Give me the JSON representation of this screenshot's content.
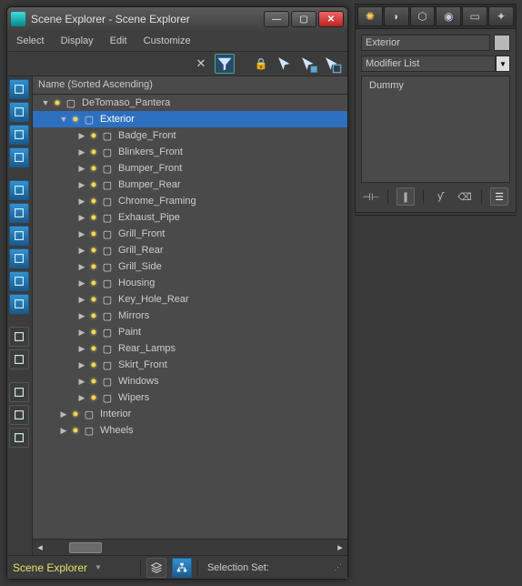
{
  "window": {
    "title": "Scene Explorer - Scene Explorer",
    "menus": {
      "select": "Select",
      "display": "Display",
      "edit": "Edit",
      "customize": "Customize"
    },
    "column_header": "Name (Sorted Ascending)",
    "status_label": "Scene Explorer",
    "selection_set_label": "Selection Set:"
  },
  "side_tool_names": [
    "sphere-icon",
    "camera-icon",
    "select-all-icon",
    "video-icon",
    "freeze-icon",
    "layers-icon",
    "hide-icon",
    "highlight-icon",
    "snow-icon",
    "expand-icon",
    "list-icon",
    "page-icon",
    "filter-icon",
    "settings-icon",
    "link-icon"
  ],
  "tree": [
    {
      "depth": 0,
      "arrow": "down",
      "label": "DeTomaso_Pantera",
      "selected": false
    },
    {
      "depth": 1,
      "arrow": "down",
      "label": "Exterior",
      "selected": true
    },
    {
      "depth": 2,
      "arrow": "right",
      "label": "Badge_Front"
    },
    {
      "depth": 2,
      "arrow": "right",
      "label": "Blinkers_Front"
    },
    {
      "depth": 2,
      "arrow": "right",
      "label": "Bumper_Front"
    },
    {
      "depth": 2,
      "arrow": "right",
      "label": "Bumper_Rear"
    },
    {
      "depth": 2,
      "arrow": "right",
      "label": "Chrome_Framing"
    },
    {
      "depth": 2,
      "arrow": "right",
      "label": "Exhaust_Pipe"
    },
    {
      "depth": 2,
      "arrow": "right",
      "label": "Grill_Front"
    },
    {
      "depth": 2,
      "arrow": "right",
      "label": "Grill_Rear"
    },
    {
      "depth": 2,
      "arrow": "right",
      "label": "Grill_Side"
    },
    {
      "depth": 2,
      "arrow": "right",
      "label": "Housing"
    },
    {
      "depth": 2,
      "arrow": "right",
      "label": "Key_Hole_Rear"
    },
    {
      "depth": 2,
      "arrow": "right",
      "label": "Mirrors"
    },
    {
      "depth": 2,
      "arrow": "right",
      "label": "Paint"
    },
    {
      "depth": 2,
      "arrow": "right",
      "label": "Rear_Lamps"
    },
    {
      "depth": 2,
      "arrow": "right",
      "label": "Skirt_Front"
    },
    {
      "depth": 2,
      "arrow": "right",
      "label": "Windows"
    },
    {
      "depth": 2,
      "arrow": "right",
      "label": "Wipers"
    },
    {
      "depth": 1,
      "arrow": "right",
      "label": "Interior"
    },
    {
      "depth": 1,
      "arrow": "right",
      "label": "Wheels"
    }
  ],
  "right_panel": {
    "tabs": [
      "create-icon",
      "modify-icon",
      "hierarchy-icon",
      "motion-icon",
      "display-icon",
      "utilities-icon"
    ],
    "object_name": "Exterior",
    "modifier_list_label": "Modifier List",
    "stack_item": "Dummy"
  }
}
